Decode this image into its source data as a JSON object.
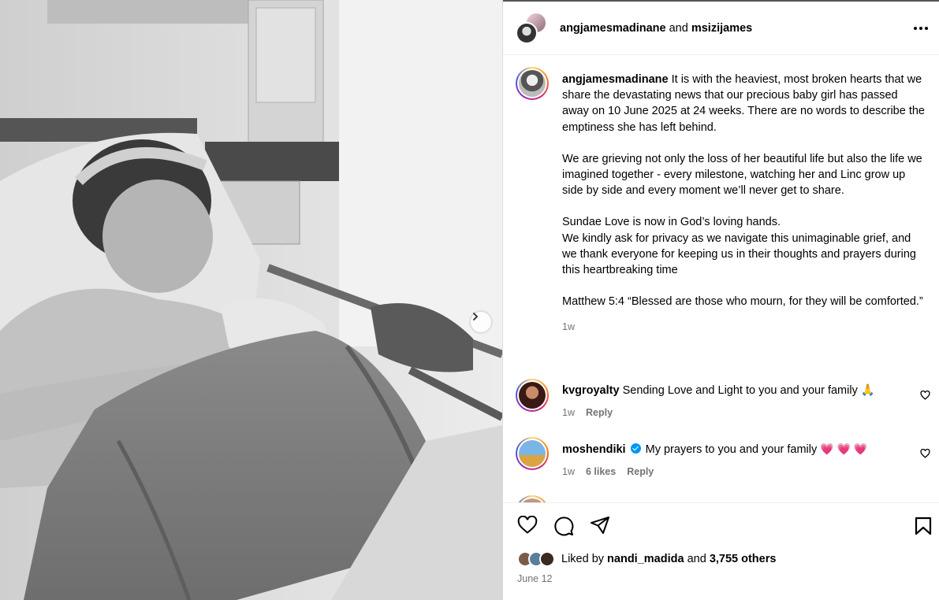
{
  "post": {
    "header": {
      "user1": "angjamesmadinane",
      "joiner": "and",
      "user2": "msizijames"
    },
    "caption": {
      "username": "angjamesmadinane",
      "paragraphs": [
        "It is with the heaviest, most broken hearts that we share the devastating news that our precious baby girl has passed away on 10 June 2025 at 24 weeks. There are no words to describe the emptiness she has left behind.",
        "We are grieving not only the loss of her beautiful life but also the life we imagined together - every milestone, watching her and Linc grow up side by side and every moment we’ll never get to share.",
        "Sundae Love is now in God’s loving hands.\nWe kindly ask for privacy as we navigate this unimaginable grief, and we thank everyone for keeping us in their thoughts and prayers during this heartbreaking time",
        "Matthew 5:4 “Blessed are those who mourn, for they will be comforted.”"
      ],
      "time": "1w"
    },
    "comments": [
      {
        "username": "kvgroyalty",
        "text": "Sending Love and Light to you and your family 🙏",
        "time": "1w",
        "likes": "",
        "reply": "Reply"
      },
      {
        "username": "moshendiki",
        "text": "My prayers to you and your family",
        "hearts": "💗 💗 💗",
        "time": "1w",
        "likes": "6 likes",
        "reply": "Reply"
      }
    ],
    "liked_by": {
      "prefix": "Liked by",
      "user": "nandi_madida",
      "joiner": "and",
      "others": "3,755 others"
    },
    "date": "June 12"
  },
  "icons": {
    "more": "more-horizontal-icon",
    "like": "heart-icon",
    "comment": "comment-icon",
    "share": "share-icon",
    "save": "bookmark-icon",
    "next": "chevron-right-icon"
  },
  "colors": {
    "link_blue": "#0095f6",
    "muted": "#737373",
    "heart_pink": "#f0245e"
  }
}
